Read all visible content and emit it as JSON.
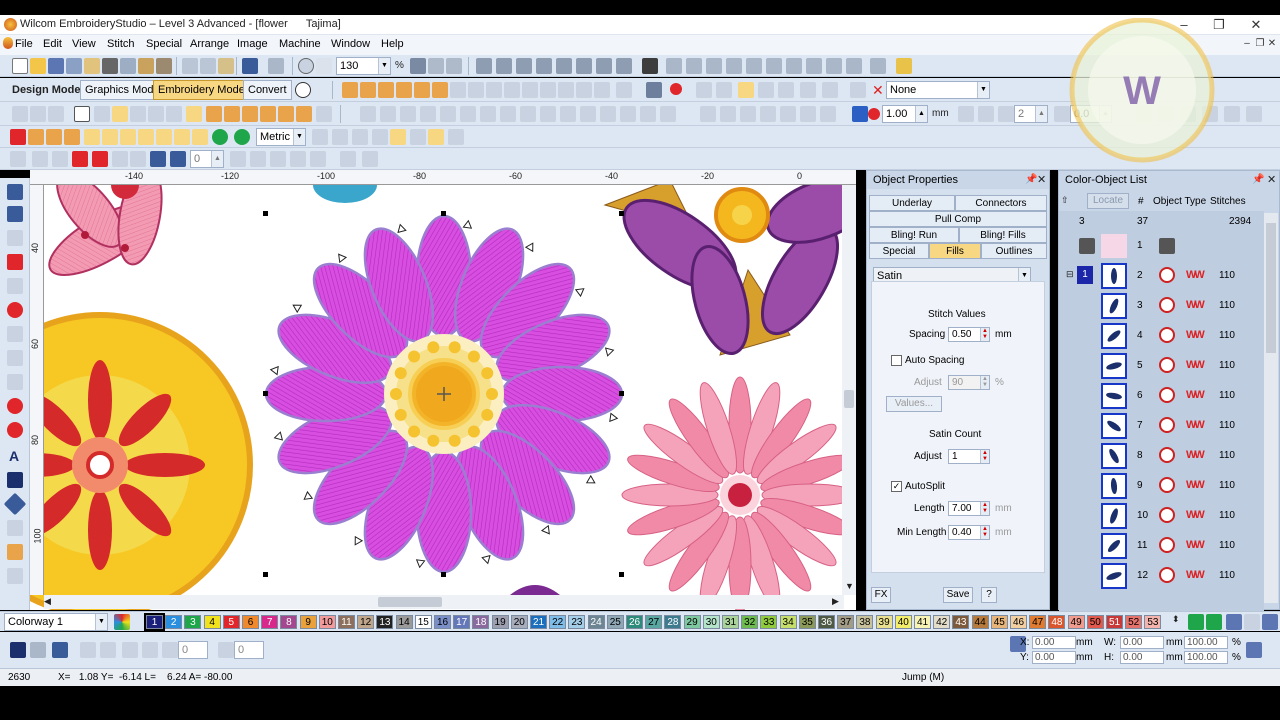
{
  "window": {
    "title": "Wilcom EmbroideryStudio – Level 3 Advanced - [flower      Tajima]",
    "controls": {
      "minimize": "–",
      "restore": "❐",
      "close": "✕"
    },
    "child_controls": {
      "minimize": "–",
      "restore": "❐",
      "close": "✕"
    }
  },
  "menu": [
    "File",
    "Edit",
    "View",
    "Stitch",
    "Special",
    "Arrange",
    "Image",
    "Machine",
    "Window",
    "Help"
  ],
  "toolbar1": {
    "zoom_value": "130",
    "zoom_unit": "%"
  },
  "toolbar2": {
    "design_mode_label": "Design Mode:",
    "graphics_mode": "Graphics Mode",
    "embroidery_mode": "Embroidery Mode",
    "convert": "Convert",
    "effect_value": "None",
    "size_value": "1.00",
    "size_unit": "mm",
    "count_value": "2",
    "angle_value": "0.0"
  },
  "toolbar3": {
    "units": "Metric"
  },
  "toolbar4": {
    "value": "0"
  },
  "ruler": {
    "h_ticks": [
      "-140",
      "-120",
      "-100",
      "-80",
      "-60",
      "-40",
      "-20",
      "0"
    ],
    "v_ticks": [
      "40",
      "60",
      "80",
      "100"
    ]
  },
  "object_properties": {
    "title": "Object Properties",
    "tabs": [
      "Underlay",
      "Connectors",
      "Pull Comp",
      "Bling! Run",
      "Bling! Fills",
      "Special",
      "Fills",
      "Outlines"
    ],
    "fill_type": "Satin",
    "stitch_values_label": "Stitch Values",
    "spacing_label": "Spacing",
    "spacing_value": "0.50",
    "spacing_unit": "mm",
    "auto_spacing_label": "Auto Spacing",
    "adjust_label": "Adjust",
    "adjust_value": "90",
    "adjust_unit": "%",
    "values_button": "Values...",
    "satin_count_label": "Satin Count",
    "satin_adjust_label": "Adjust",
    "satin_adjust_value": "1",
    "autosplit_label": "AutoSplit",
    "length_label": "Length",
    "length_value": "7.00",
    "length_unit": "mm",
    "min_length_label": "Min Length",
    "min_length_value": "0.40",
    "min_length_unit": "mm",
    "fx_button": "FX",
    "save_button": "Save",
    "help_button": "?"
  },
  "color_object_list": {
    "title": "Color-Object List",
    "locate_button": "Locate",
    "headers": {
      "num": "#",
      "type": "Object Type",
      "stitches": "Stitches"
    },
    "summary": {
      "colors": "3",
      "objects": "37",
      "stitches": "2394"
    },
    "first_row_num": "1",
    "rows": [
      {
        "num": "2",
        "stitches": "110"
      },
      {
        "num": "3",
        "stitches": "110"
      },
      {
        "num": "4",
        "stitches": "110"
      },
      {
        "num": "5",
        "stitches": "110"
      },
      {
        "num": "6",
        "stitches": "110"
      },
      {
        "num": "7",
        "stitches": "110"
      },
      {
        "num": "8",
        "stitches": "110"
      },
      {
        "num": "9",
        "stitches": "110"
      },
      {
        "num": "10",
        "stitches": "110"
      },
      {
        "num": "11",
        "stitches": "110"
      },
      {
        "num": "12",
        "stitches": "110"
      }
    ],
    "selected_color_badge": "1"
  },
  "colorway": {
    "name": "Colorway 1",
    "chips": [
      {
        "n": "1",
        "c": "#1a1f7a",
        "t": "#fff"
      },
      {
        "n": "2",
        "c": "#2b8fe0",
        "t": "#fff"
      },
      {
        "n": "3",
        "c": "#1fa64a",
        "t": "#fff"
      },
      {
        "n": "4",
        "c": "#f0e21c",
        "t": "#000"
      },
      {
        "n": "5",
        "c": "#e0262a",
        "t": "#fff"
      },
      {
        "n": "6",
        "c": "#f0882c",
        "t": "#000"
      },
      {
        "n": "7",
        "c": "#d8288c",
        "t": "#fff"
      },
      {
        "n": "8",
        "c": "#a3478f",
        "t": "#fff"
      },
      {
        "n": "9",
        "c": "#e9a23b",
        "t": "#000"
      },
      {
        "n": "10",
        "c": "#f19b9b",
        "t": "#000"
      },
      {
        "n": "11",
        "c": "#8d6f5c",
        "t": "#fff"
      },
      {
        "n": "12",
        "c": "#bfa58a",
        "t": "#000"
      },
      {
        "n": "13",
        "c": "#222222",
        "t": "#fff"
      },
      {
        "n": "14",
        "c": "#9a9a9a",
        "t": "#000"
      },
      {
        "n": "15",
        "c": "#ffffff",
        "t": "#000"
      },
      {
        "n": "16",
        "c": "#7a8fc7",
        "t": "#000"
      },
      {
        "n": "17",
        "c": "#6477b8",
        "t": "#fff"
      },
      {
        "n": "18",
        "c": "#8a6a9e",
        "t": "#fff"
      },
      {
        "n": "19",
        "c": "#9d9fb0",
        "t": "#000"
      },
      {
        "n": "20",
        "c": "#a7acbb",
        "t": "#000"
      },
      {
        "n": "21",
        "c": "#1b6fbd",
        "t": "#fff"
      },
      {
        "n": "22",
        "c": "#7fbde8",
        "t": "#000"
      },
      {
        "n": "23",
        "c": "#a4cde8",
        "t": "#000"
      },
      {
        "n": "24",
        "c": "#6e8694",
        "t": "#fff"
      },
      {
        "n": "25",
        "c": "#8fa7b5",
        "t": "#000"
      },
      {
        "n": "26",
        "c": "#2e8a7a",
        "t": "#fff"
      },
      {
        "n": "27",
        "c": "#5aa6a0",
        "t": "#000"
      },
      {
        "n": "28",
        "c": "#3d7b8f",
        "t": "#fff"
      },
      {
        "n": "29",
        "c": "#7ec8a0",
        "t": "#000"
      },
      {
        "n": "30",
        "c": "#b3e3c8",
        "t": "#000"
      },
      {
        "n": "31",
        "c": "#a9d39a",
        "t": "#000"
      },
      {
        "n": "32",
        "c": "#6dbb4f",
        "t": "#000"
      },
      {
        "n": "33",
        "c": "#8fc93c",
        "t": "#000"
      },
      {
        "n": "34",
        "c": "#c5dd6b",
        "t": "#000"
      },
      {
        "n": "35",
        "c": "#8b9a5a",
        "t": "#000"
      },
      {
        "n": "36",
        "c": "#4f5a45",
        "t": "#fff"
      },
      {
        "n": "37",
        "c": "#a29c86",
        "t": "#000"
      },
      {
        "n": "38",
        "c": "#c7c19b",
        "t": "#000"
      },
      {
        "n": "39",
        "c": "#e8e08e",
        "t": "#000"
      },
      {
        "n": "40",
        "c": "#f3ee6a",
        "t": "#000"
      },
      {
        "n": "41",
        "c": "#f7f3b5",
        "t": "#000"
      },
      {
        "n": "42",
        "c": "#e3dcc8",
        "t": "#000"
      },
      {
        "n": "43",
        "c": "#7e5a3c",
        "t": "#fff"
      },
      {
        "n": "44",
        "c": "#b77a3d",
        "t": "#000"
      },
      {
        "n": "45",
        "c": "#e6b378",
        "t": "#000"
      },
      {
        "n": "46",
        "c": "#f2cfa0",
        "t": "#000"
      },
      {
        "n": "47",
        "c": "#e07b32",
        "t": "#000"
      },
      {
        "n": "48",
        "c": "#d9562e",
        "t": "#fff"
      },
      {
        "n": "49",
        "c": "#f09b8d",
        "t": "#000"
      },
      {
        "n": "50",
        "c": "#e25a4e",
        "t": "#000"
      },
      {
        "n": "51",
        "c": "#c83a3a",
        "t": "#fff"
      },
      {
        "n": "52",
        "c": "#e6736b",
        "t": "#000"
      },
      {
        "n": "53",
        "c": "#f4b3ac",
        "t": "#000"
      }
    ]
  },
  "bottom": {
    "field1": "0",
    "field2": "0",
    "x_label": "X:",
    "x_value": "0.00",
    "y_label": "Y:",
    "y_value": "0.00",
    "w_label": "W:",
    "w_value": "0.00",
    "h_label": "H:",
    "h_value": "0.00",
    "unit": "mm",
    "pct1": "100.00",
    "pct2": "100.00",
    "pct_unit": "%"
  },
  "status": {
    "stitch_count": "2630",
    "coords": "X=   1.08 Y=  -6.14 L=    6.24 A= -80.00",
    "mode": "Jump (M)"
  },
  "watermark": {
    "letter": "W"
  },
  "colors": {
    "accent": "#f8d783",
    "panel": "#dde7f3",
    "selection": "#1737c9"
  }
}
